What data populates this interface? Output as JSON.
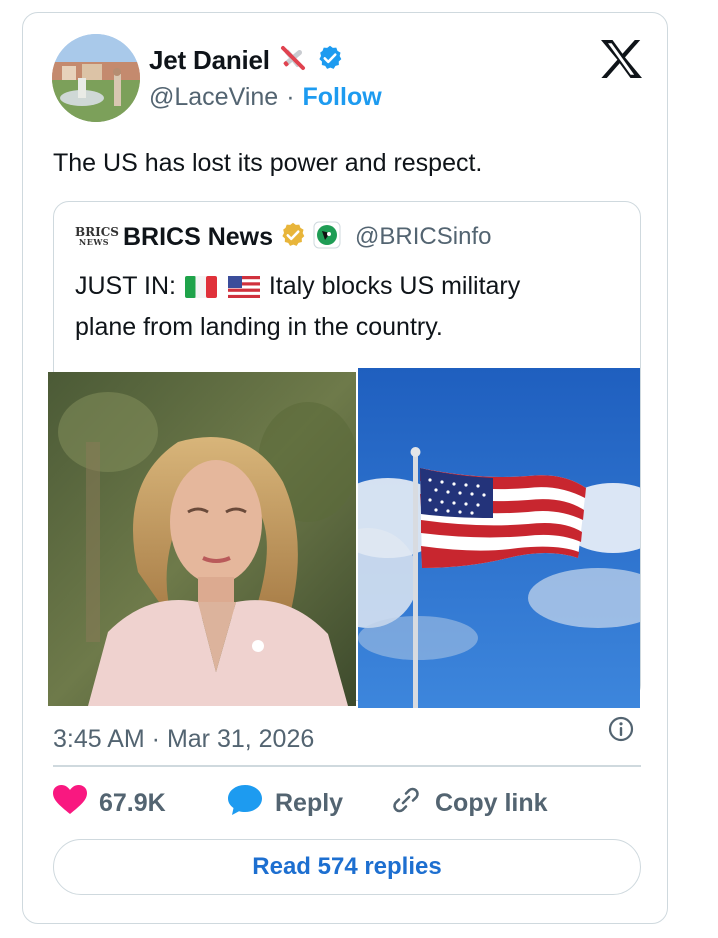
{
  "author": {
    "name": "Jet Daniel",
    "handle": "@LaceVine",
    "separator": "·",
    "follow_label": "Follow",
    "name_emoji_icon": "airplane-crossed-icon",
    "verified_icon": "verified-badge-icon",
    "verified_color": "#1d9bf0"
  },
  "brand_icon": "x-logo-icon",
  "tweet": {
    "text": "The US has lost its power and respect."
  },
  "quote": {
    "logo_text": "BRICS",
    "logo_subtext": "NEWS",
    "name": "BRICS News",
    "verified_icon": "gold-verified-badge-icon",
    "verified_color": "#e8b53a",
    "affiliate_icon": "brics-affiliate-badge-icon",
    "handle": "@BRICSinfo",
    "text_prefix": "JUST IN:",
    "flag_icons": [
      "italy-flag-icon",
      "us-flag-icon"
    ],
    "text_body": "Italy blocks US military",
    "text_line2": "plane from landing in the country.",
    "media": [
      "woman-portrait-photo",
      "american-flag-on-pole-photo"
    ]
  },
  "meta": {
    "timestamp": "3:45 AM · Mar 31, 2026",
    "info_icon": "info-circle-icon"
  },
  "actions": {
    "likes": "67.9K",
    "like_color": "#f91880",
    "reply_label": "Reply",
    "reply_color": "#1d9bf0",
    "copy_label": "Copy link"
  },
  "read_replies_label": "Read 574 replies",
  "colors": {
    "accent": "#1d9bf0",
    "muted": "#536471",
    "border": "#cfd9de",
    "text": "#0f1419"
  }
}
